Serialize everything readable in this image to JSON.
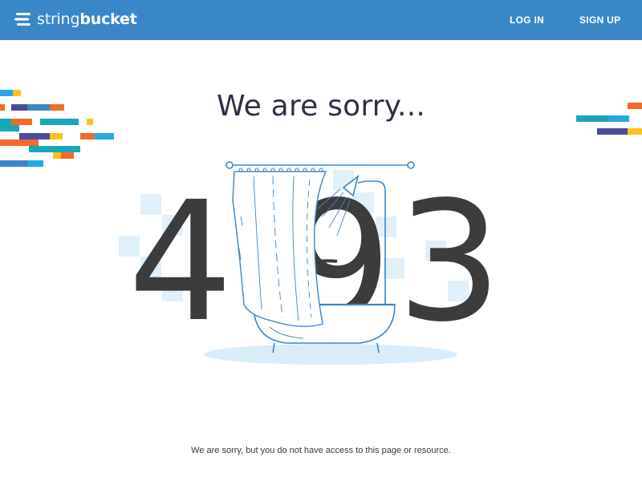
{
  "header": {
    "brand_light": "string",
    "brand_bold": "bucket",
    "login_label": "LOG IN",
    "signup_label": "SIGN UP"
  },
  "main": {
    "headline": "We are sorry...",
    "error_code": [
      "4",
      "9",
      "3"
    ],
    "message": "We are sorry, but you do not have access to this page or resource."
  },
  "colors": {
    "header_bg": "#3a87c8",
    "digit": "#3c3c3c",
    "accent_blue": "#3a87c8",
    "stripe_orange": "#f36a2a",
    "stripe_yellow": "#fbc21b",
    "stripe_purple": "#4b4b9e",
    "stripe_teal": "#17a8b8",
    "stripe_lightblue": "#22a9e8"
  },
  "icons": {
    "logo": "stacked-bars-logo-icon",
    "illustration": "shower-bathtub-illustration"
  }
}
